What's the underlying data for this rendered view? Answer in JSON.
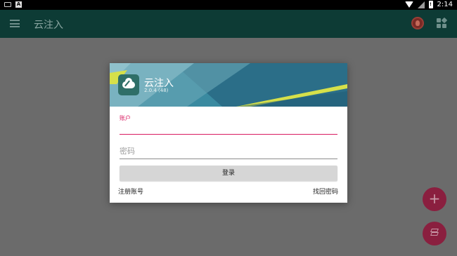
{
  "status_bar": {
    "left_icons": [
      "keyboard-icon",
      "a-icon"
    ],
    "a_icon_text": "A",
    "battery_text": "!",
    "time": "2:14"
  },
  "app_bar": {
    "title": "云注入",
    "colors": {
      "background": "#0d3b35"
    }
  },
  "dialog": {
    "app_name": "云注入",
    "version": "2.0.4 (48)",
    "account": {
      "label": "账户",
      "value": ""
    },
    "password": {
      "placeholder": "密码",
      "value": ""
    },
    "login_label": "登录",
    "register_label": "注册账号",
    "recover_label": "找回密码",
    "colors": {
      "accent": "#d81b60",
      "banner_dark": "#2b6e88",
      "banner_light": "#8fc1cc",
      "stripe": "#d6e04a"
    }
  },
  "fab": {
    "add_label": "+",
    "colors": {
      "background": "#8a1f3f"
    }
  }
}
